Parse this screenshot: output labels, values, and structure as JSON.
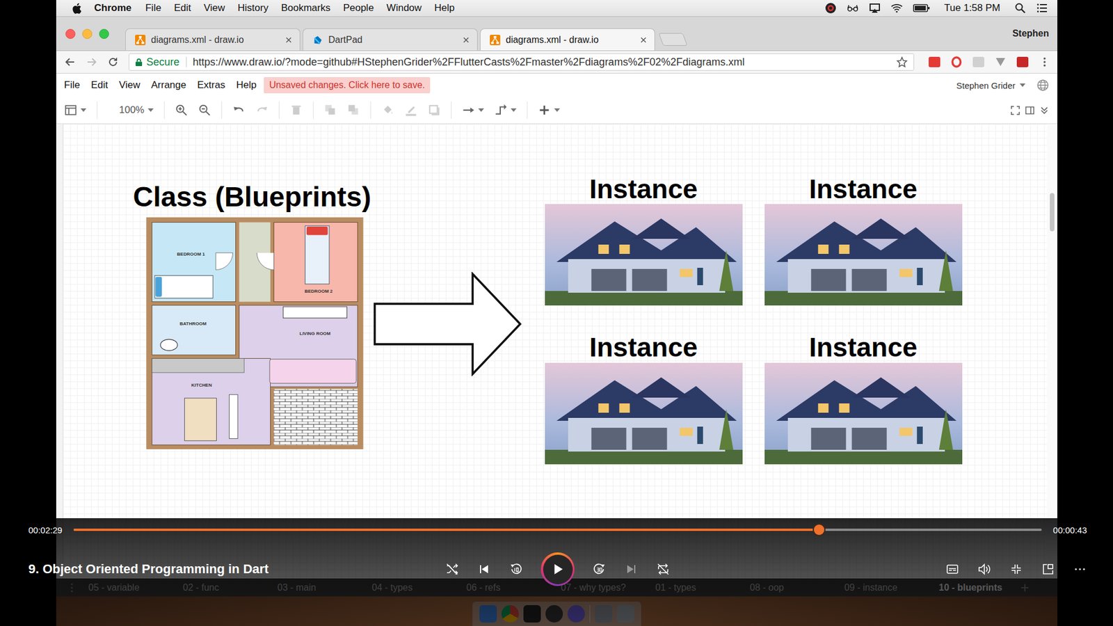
{
  "menubar": {
    "app": "Chrome",
    "items": [
      "File",
      "Edit",
      "View",
      "History",
      "Bookmarks",
      "People",
      "Window",
      "Help"
    ],
    "clock": "Tue 1:58 PM"
  },
  "browser": {
    "tabs": [
      {
        "label": "diagrams.xml - draw.io",
        "kind": "drawio",
        "selected": false
      },
      {
        "label": "DartPad",
        "kind": "dartpad",
        "selected": false
      },
      {
        "label": "diagrams.xml - draw.io",
        "kind": "drawio",
        "selected": true
      }
    ],
    "profile": "Stephen",
    "secure": "Secure",
    "url": "https://www.draw.io/?mode=github#HStephenGrider%2FFlutterCasts%2Fmaster%2Fdiagrams%2F02%2Fdiagrams.xml"
  },
  "drawio": {
    "menu": [
      "File",
      "Edit",
      "View",
      "Arrange",
      "Extras",
      "Help"
    ],
    "notice": "Unsaved changes. Click here to save.",
    "user": "Stephen Grider",
    "zoom": "100%"
  },
  "diagram": {
    "class_title": "Class (Blueprints)",
    "rooms": [
      {
        "label": "BEDROOM 1",
        "color": "#c6e7f6"
      },
      {
        "label": "BEDROOM 2",
        "color": "#f7b7aa"
      },
      {
        "label": "BATHROOM",
        "color": "#d8eaf7"
      },
      {
        "label": "LIVING ROOM",
        "color": "#dcd0ea"
      },
      {
        "label": "KITCHEN",
        "color": "#dcd0ea"
      }
    ],
    "instances": [
      {
        "label": "Instance"
      },
      {
        "label": "Instance"
      },
      {
        "label": "Instance"
      },
      {
        "label": "Instance"
      }
    ]
  },
  "page_tabs": [
    {
      "label": "05 - variable",
      "selected": false
    },
    {
      "label": "02 - func",
      "selected": false
    },
    {
      "label": "03 - main",
      "selected": false
    },
    {
      "label": "04 - types",
      "selected": false
    },
    {
      "label": "06 - refs",
      "selected": false
    },
    {
      "label": "07 - why types?",
      "selected": false
    },
    {
      "label": "01 - types",
      "selected": false
    },
    {
      "label": "08 - oop",
      "selected": false
    },
    {
      "label": "09 - instance",
      "selected": false
    },
    {
      "label": "10 - blueprints",
      "selected": true
    }
  ],
  "player": {
    "title": "9. Object Oriented Programming in Dart",
    "elapsed": "00:02:29",
    "remaining": "00:00:43",
    "level": 0.77,
    "playing": false
  }
}
